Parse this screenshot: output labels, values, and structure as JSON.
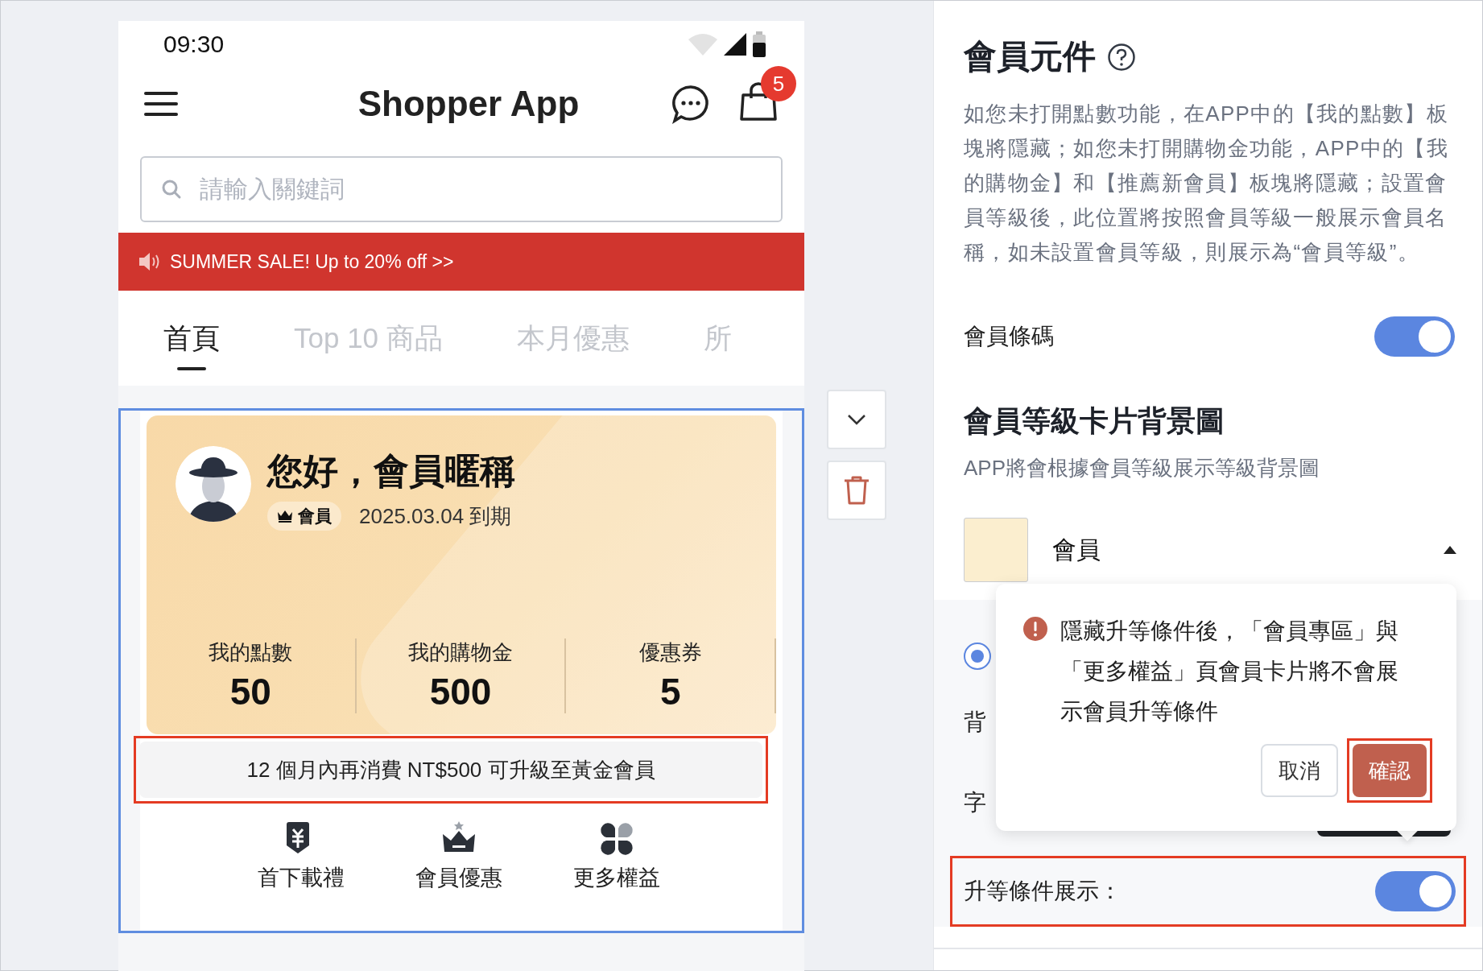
{
  "phone": {
    "status_bar": {
      "time": "09:30"
    },
    "header": {
      "title": "Shopper App",
      "cart_badge": "5"
    },
    "search": {
      "placeholder": "請輸入關鍵詞"
    },
    "banner": {
      "text": "SUMMER SALE! Up to 20% off >>"
    },
    "tabs": [
      {
        "label": "首頁",
        "selected": true
      },
      {
        "label": "Top 10 商品",
        "selected": false
      },
      {
        "label": "本月優惠",
        "selected": false
      },
      {
        "label": "所",
        "selected": false
      }
    ]
  },
  "member_component": {
    "selected": true,
    "greeting": "您好，會員暱稱",
    "level_badge": "會員",
    "expiry": "2025.03.04 到期",
    "stats": [
      {
        "label": "我的點數",
        "value": "50"
      },
      {
        "label": "我的購物金",
        "value": "500"
      },
      {
        "label": "優惠券",
        "value": "5"
      }
    ],
    "upgrade_notice": {
      "text": "12 個月內再消費 NT$500 可升級至黃金會員",
      "highlighted": true
    },
    "shortcuts": [
      {
        "label": "首下載禮",
        "kind": "gift"
      },
      {
        "label": "會員優惠",
        "kind": "crown"
      },
      {
        "label": "更多權益",
        "kind": "clover"
      }
    ]
  },
  "settings_panel": {
    "title": "會員元件",
    "description": "如您未打開點數功能，在APP中的【我的點數】板塊將隱藏；如您未打開購物金功能，APP中的【我的購物金】和【推薦新會員】板塊將隱藏；設置會員等級後，此位置將按照會員等級一般展示會員名稱，如未設置會員等級，則展示為“會員等級”。",
    "barcode_toggle": {
      "label": "會員條碼",
      "on": true
    },
    "card_background": {
      "title": "會員等級卡片背景圖",
      "subtitle": "APP將會根據會員等級展示等級背景圖",
      "level": {
        "name": "會員",
        "expanded": true
      }
    },
    "radio": {
      "selected": true
    },
    "rows": [
      {
        "label": "背"
      },
      {
        "label": "字"
      }
    ],
    "upgrade_toggle": {
      "label": "升等條件展示：",
      "on": true,
      "highlighted": true
    },
    "popconfirm": {
      "message": "隱藏升等條件後，「會員專區」與「更多權益」頁會員卡片將不會展示會員升等條件",
      "buttons": [
        {
          "label": "取消",
          "kind": "cancel",
          "highlighted": false
        },
        {
          "label": "確認",
          "kind": "confirm",
          "highlighted": true
        }
      ]
    }
  }
}
